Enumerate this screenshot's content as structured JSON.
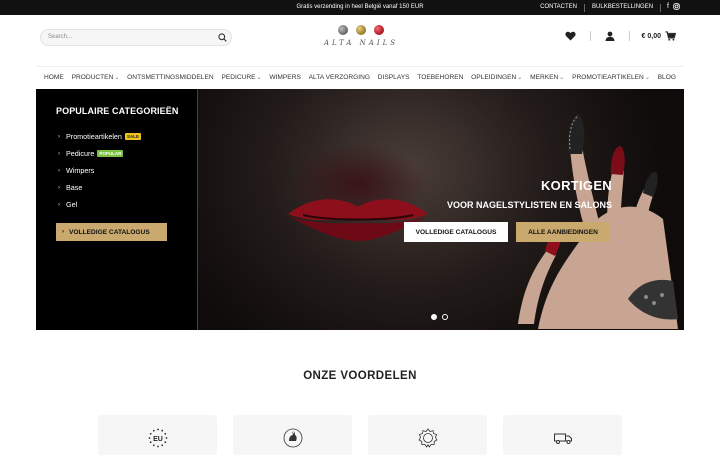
{
  "topbar": {
    "promo": "Gratis verzending in heel België vanaf 150 EUR",
    "links": [
      "CONTACTEN",
      "BULKBESTELLINGEN"
    ],
    "social": [
      "facebook-icon",
      "instagram-icon"
    ]
  },
  "header": {
    "search_placeholder": "Search...",
    "logo_text": "ALTA NAILS",
    "logo_colors": [
      "#6f6f6f",
      "#a3832f",
      "#b3202a"
    ],
    "cart_total": "€ 0,00"
  },
  "nav": {
    "items": [
      {
        "label": "HOME",
        "dropdown": false
      },
      {
        "label": "PRODUCTEN",
        "dropdown": true
      },
      {
        "label": "ONTSMETTINGSMIDDELEN",
        "dropdown": false
      },
      {
        "label": "PEDICURE",
        "dropdown": true
      },
      {
        "label": "WIMPERS",
        "dropdown": false
      },
      {
        "label": "ALTA VERZORGING",
        "dropdown": false
      },
      {
        "label": "DISPLAYS",
        "dropdown": false
      },
      {
        "label": "TOEBEHOREN",
        "dropdown": false
      },
      {
        "label": "OPLEIDINGEN",
        "dropdown": true
      },
      {
        "label": "MERKEN",
        "dropdown": true
      },
      {
        "label": "PROMOTIEARTIKELEN",
        "dropdown": true
      },
      {
        "label": "BLOG",
        "dropdown": false
      }
    ]
  },
  "categories": {
    "title": "POPULAIRE CATEGORIEËN",
    "items": [
      {
        "label": "Promotieartikelen",
        "badge": "SALE"
      },
      {
        "label": "Pedicure",
        "badge": "POPULAR"
      },
      {
        "label": "Wimpers",
        "badge": ""
      },
      {
        "label": "Base",
        "badge": ""
      },
      {
        "label": "Gel",
        "badge": ""
      }
    ],
    "button": "VOLLEDIGE CATALOGUS"
  },
  "slide": {
    "title": "KORTIGEN",
    "subtitle": "VOOR NAGELSTYLISTEN EN SALONS",
    "btn_catalog": "VOLLEDIGE CATALOGUS",
    "btn_offers": "ALLE AANBIEDINGEN",
    "active_slide": 1,
    "slide_count": 2
  },
  "colors": {
    "gold": "#c9a96e",
    "sale_badge": "#f0c419",
    "popular_badge": "#7cc242"
  },
  "advantages": {
    "title": "ONZE VOORDELEN",
    "icons": [
      "eu-icon",
      "cruelty-free-icon",
      "quality-badge-icon",
      "delivery-truck-icon"
    ],
    "eu_label": "EU"
  }
}
